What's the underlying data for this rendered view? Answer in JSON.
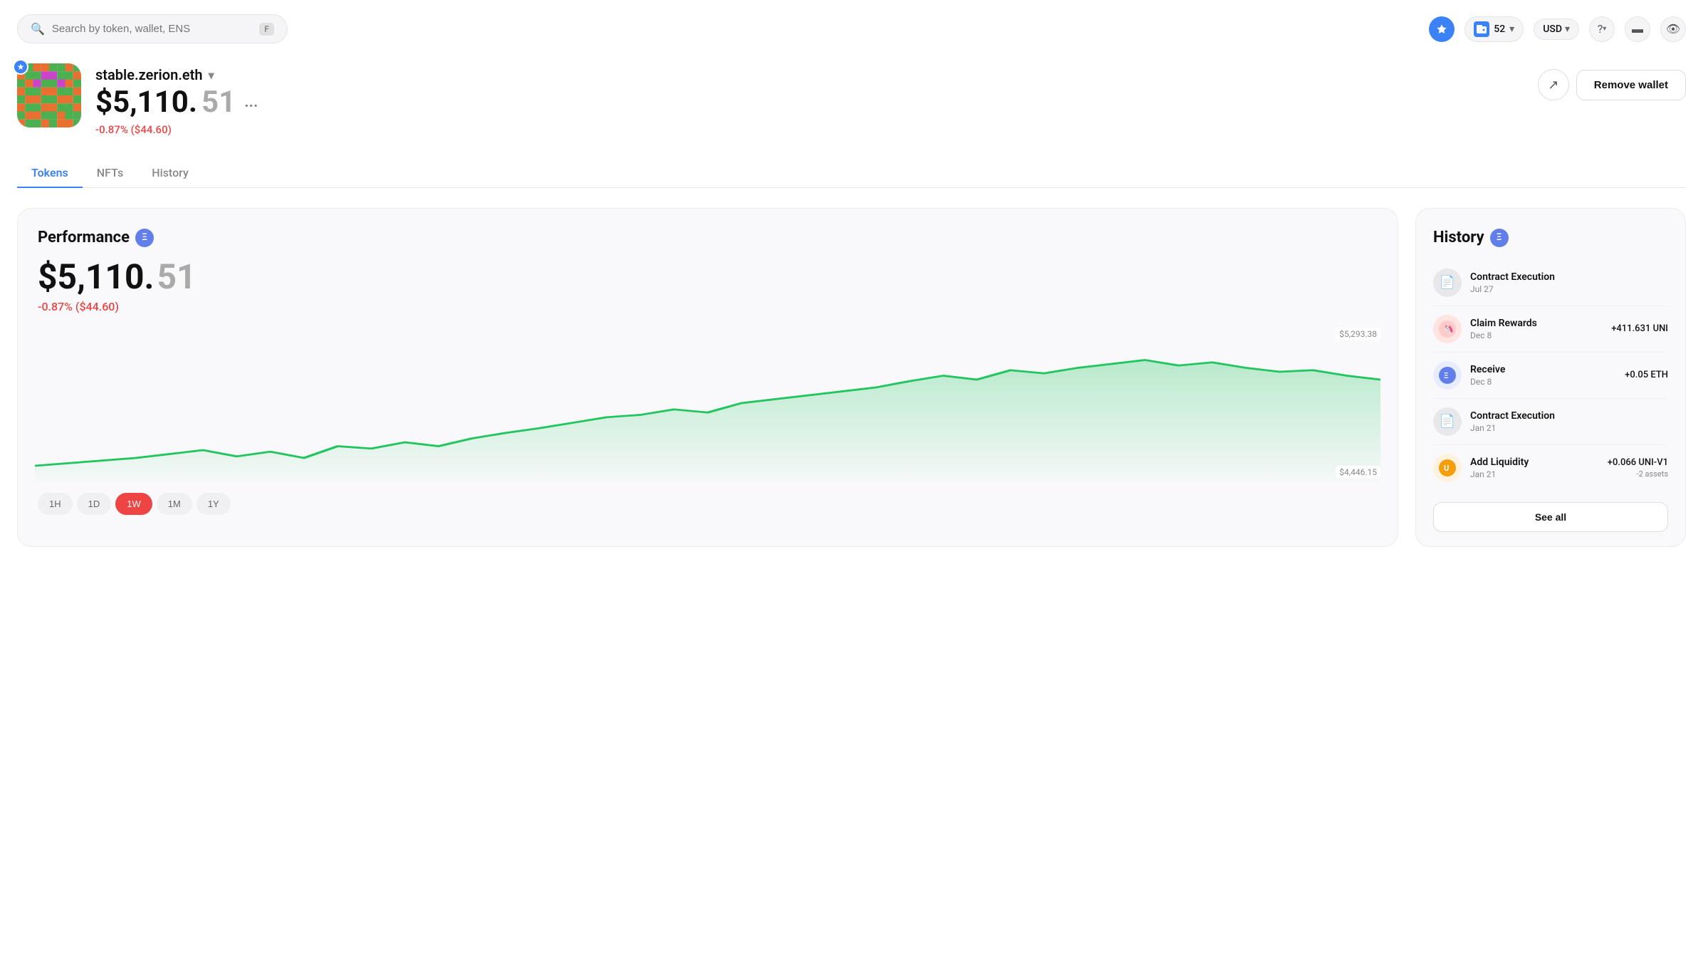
{
  "header": {
    "search_placeholder": "Search by token, wallet, ENS",
    "search_kbd": "F",
    "wallet_count": "52",
    "currency": "USD",
    "star_label": "Favorite"
  },
  "wallet": {
    "name": "stable.zerion.eth",
    "balance_dollars": "$5,110.",
    "balance_cents": "51",
    "balance_full": "$5,110.51",
    "more_dots": "...",
    "change_text": "-0.87% ($44.60)",
    "remove_label": "Remove wallet",
    "share_icon": "↗"
  },
  "tabs": [
    {
      "label": "Tokens",
      "active": true
    },
    {
      "label": "NFTs",
      "active": false
    },
    {
      "label": "History",
      "active": false
    }
  ],
  "performance": {
    "title": "Performance",
    "balance_dollars": "$5,110.",
    "balance_cents": "51",
    "change_text": "-0.87% ($44.60)",
    "chart_high": "$5,293.38",
    "chart_low": "$4,446.15",
    "time_filters": [
      "1H",
      "1D",
      "1W",
      "1M",
      "1Y"
    ],
    "active_filter": "1W"
  },
  "history": {
    "title": "History",
    "see_all_label": "See all",
    "items": [
      {
        "title": "Contract Execution",
        "date": "Jul 27",
        "amount": "",
        "sub": "",
        "icon_type": "contract"
      },
      {
        "title": "Claim Rewards",
        "date": "Dec 8",
        "amount": "+411.631 UNI",
        "sub": "",
        "icon_type": "claim"
      },
      {
        "title": "Receive",
        "date": "Dec 8",
        "amount": "+0.05 ETH",
        "sub": "",
        "icon_type": "eth"
      },
      {
        "title": "Contract Execution",
        "date": "Jan 21",
        "amount": "",
        "sub": "",
        "icon_type": "contract"
      },
      {
        "title": "Add Liquidity",
        "date": "Jan 21",
        "amount": "+0.066 UNI-V1",
        "sub": "-2 assets",
        "icon_type": "liquidity"
      }
    ]
  }
}
